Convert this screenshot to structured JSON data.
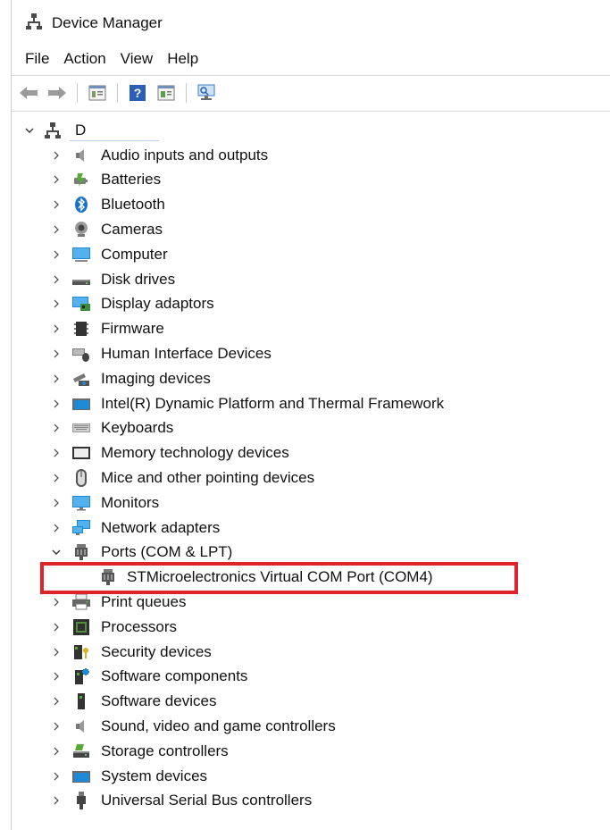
{
  "window": {
    "title": "Device Manager",
    "icon": "device-manager-icon"
  },
  "menu": {
    "items": [
      {
        "label": "File"
      },
      {
        "label": "Action"
      },
      {
        "label": "View"
      },
      {
        "label": "Help"
      }
    ]
  },
  "toolbar": {
    "buttons": [
      {
        "icon": "back-arrow-icon"
      },
      {
        "icon": "forward-arrow-icon"
      },
      {
        "icon": "properties-icon"
      },
      {
        "icon": "help-icon"
      },
      {
        "icon": "update-driver-icon"
      },
      {
        "icon": "scan-hardware-icon"
      }
    ]
  },
  "tree": {
    "root": {
      "label": "D",
      "expanded": true,
      "icon": "computer-root-icon"
    },
    "categories": [
      {
        "label": "Audio inputs and outputs",
        "icon": "speaker-icon"
      },
      {
        "label": "Batteries",
        "icon": "battery-icon"
      },
      {
        "label": "Bluetooth",
        "icon": "bluetooth-icon"
      },
      {
        "label": "Cameras",
        "icon": "camera-icon"
      },
      {
        "label": "Computer",
        "icon": "computer-icon"
      },
      {
        "label": "Disk drives",
        "icon": "disk-drive-icon"
      },
      {
        "label": "Display adaptors",
        "icon": "display-adapter-icon"
      },
      {
        "label": "Firmware",
        "icon": "firmware-icon"
      },
      {
        "label": "Human Interface Devices",
        "icon": "hid-icon"
      },
      {
        "label": "Imaging devices",
        "icon": "imaging-icon"
      },
      {
        "label": "Intel(R) Dynamic Platform and Thermal Framework",
        "icon": "folder-device-icon"
      },
      {
        "label": "Keyboards",
        "icon": "keyboard-icon"
      },
      {
        "label": "Memory technology devices",
        "icon": "memory-device-icon"
      },
      {
        "label": "Mice and other pointing devices",
        "icon": "mouse-icon"
      },
      {
        "label": "Monitors",
        "icon": "monitor-icon"
      },
      {
        "label": "Network adapters",
        "icon": "network-adapter-icon"
      },
      {
        "label": "Ports (COM & LPT)",
        "icon": "port-icon",
        "expanded": true,
        "children": [
          {
            "label": "STMicroelectronics Virtual COM Port (COM4)",
            "icon": "port-icon",
            "highlighted": true
          }
        ]
      },
      {
        "label": "Print queues",
        "icon": "printer-icon"
      },
      {
        "label": "Processors",
        "icon": "processor-icon"
      },
      {
        "label": "Security devices",
        "icon": "security-device-icon"
      },
      {
        "label": "Software components",
        "icon": "software-component-icon"
      },
      {
        "label": "Software devices",
        "icon": "software-device-icon"
      },
      {
        "label": "Sound, video and game controllers",
        "icon": "sound-controller-icon"
      },
      {
        "label": "Storage controllers",
        "icon": "storage-controller-icon"
      },
      {
        "label": "System devices",
        "icon": "system-devices-icon"
      },
      {
        "label": "Universal Serial Bus controllers",
        "icon": "usb-icon"
      }
    ]
  },
  "colors": {
    "highlight_border": "#e0232a",
    "accent_blue": "#1a73c8"
  }
}
